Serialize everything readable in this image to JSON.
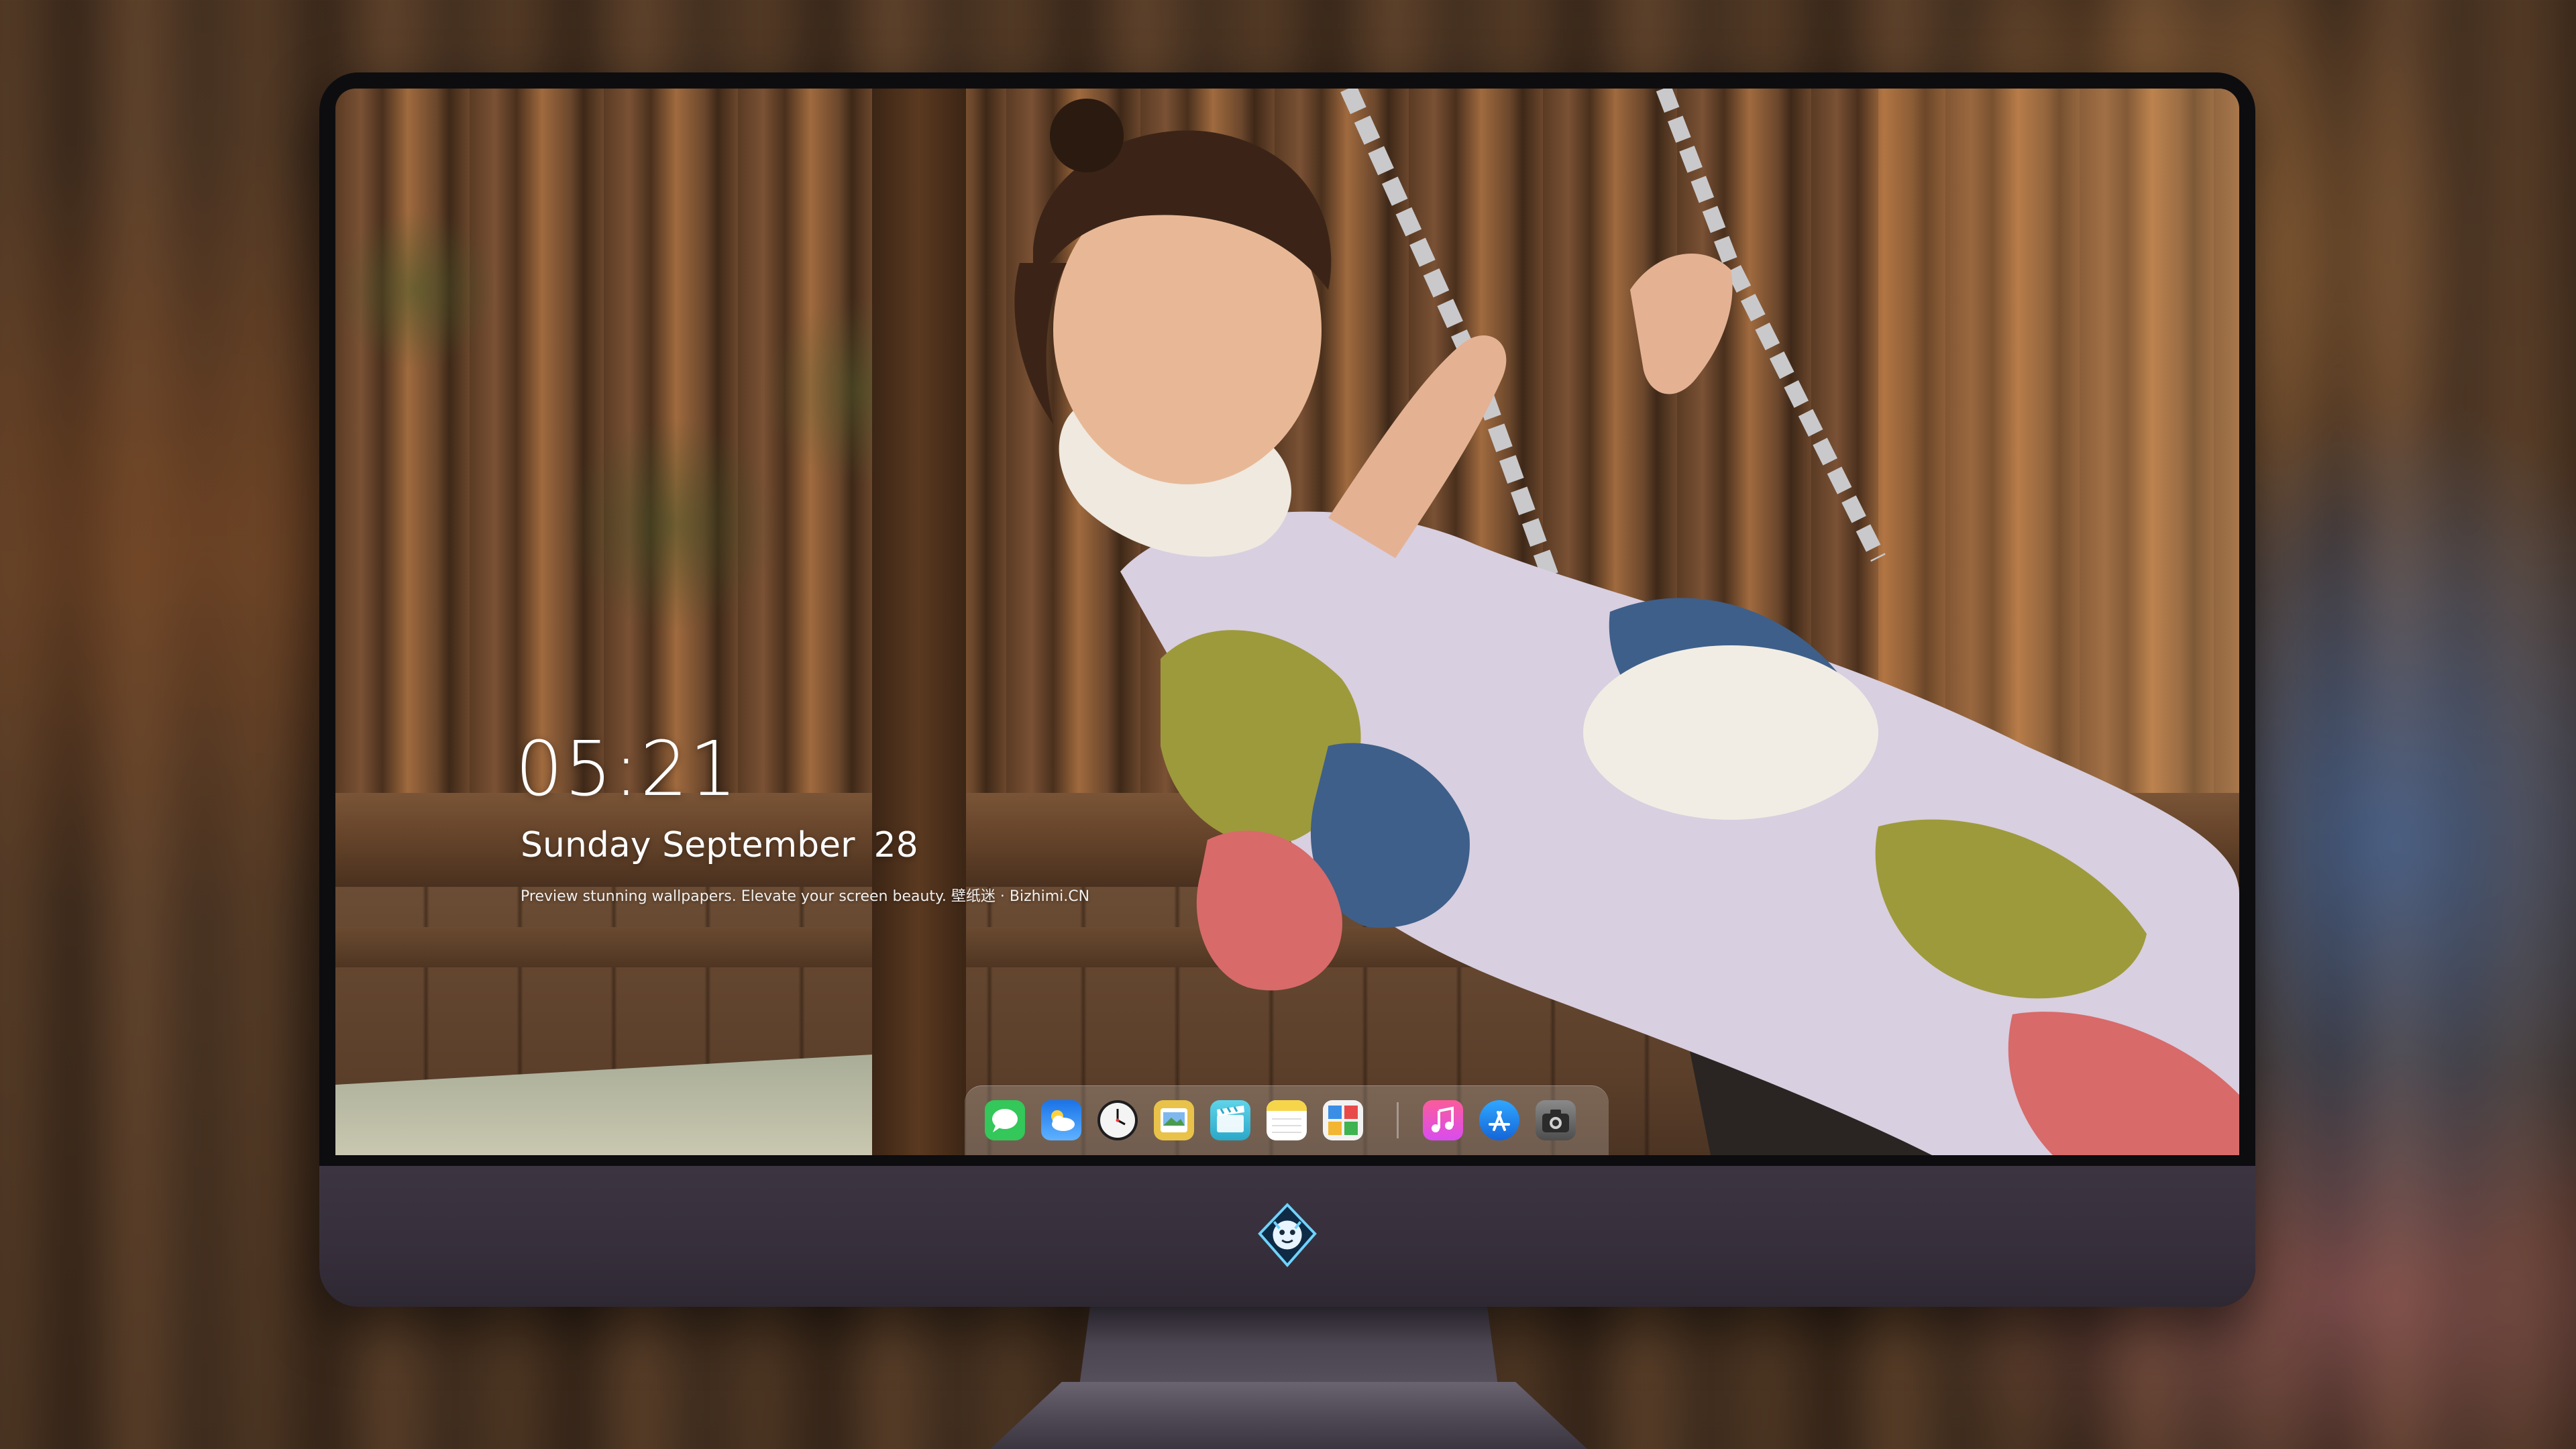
{
  "lockscreen": {
    "time": "05:21",
    "weekday_month": "Sunday September",
    "day": "28",
    "tagline": "Preview stunning wallpapers. Elevate your screen beauty. 壁纸迷 · Bizhimi.CN"
  },
  "dock": {
    "apps": [
      {
        "name": "messages-icon",
        "color": "#34c759"
      },
      {
        "name": "weather-icon",
        "color": "#2f8df5"
      },
      {
        "name": "clock-icon",
        "color": "#f4f4f4"
      },
      {
        "name": "preview-icon",
        "color": "#e9c24a"
      },
      {
        "name": "clips-icon",
        "color": "#3cc3dd"
      },
      {
        "name": "notes-icon",
        "color": "#f7d54a"
      },
      {
        "name": "photo-booth-icon",
        "color": "#f0f0f0"
      }
    ],
    "apps_right": [
      {
        "name": "music-icon",
        "color": "#f54a8c"
      },
      {
        "name": "app-store-icon",
        "color": "#1c8cf2"
      },
      {
        "name": "camera-icon",
        "color": "#6b6b6b"
      }
    ]
  },
  "monitor": {
    "logo_icon": "dragon-mascot-icon",
    "bezel_color": "#0d0d10",
    "chin_color": "#3a333f"
  }
}
